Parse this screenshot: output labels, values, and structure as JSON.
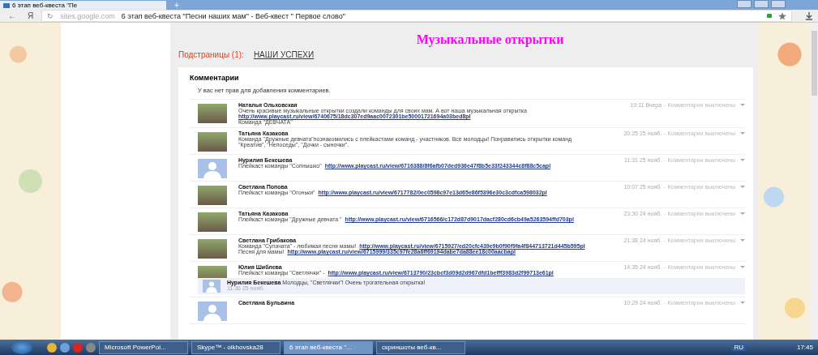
{
  "browser": {
    "tab_title": "6 этап веб-квеста \"Пе",
    "new_tab": "+",
    "back": "←",
    "logo": "Я",
    "reload": "↻",
    "domain": "sites.google.com",
    "page_title": "6 этап веб-квеста \"Песни наших мам\" - Веб-квест \" Первое слово\""
  },
  "page": {
    "title": "Музыкальные открытки",
    "subpages_label": "Подстраницы (1):",
    "subpages": [
      "НАШИ УСПЕХИ"
    ]
  },
  "comments_section": {
    "heading": "Комментарии",
    "notice": "У вас нет прав для добавления комментариев.",
    "comments": [
      {
        "kind": "photo",
        "name": "Наталья Ольховская",
        "time": "19:11 Вчера",
        "status": "- Комментарии выключены",
        "lines": [
          [
            {
              "kind": "text",
              "text": "Очень красивые музыкальные открытки создали команды для своих мам. А вот наша музыкальная открытка"
            }
          ],
          [
            {
              "kind": "link",
              "text": "http://www.playcast.ru/view/6740675/18dc307ed9aac0072301be50001721694a03bed8pl"
            }
          ],
          [
            {
              "kind": "text",
              "text": "Команда \"ДЕВЧАТА\""
            }
          ]
        ]
      },
      {
        "kind": "photo",
        "name": "Татьяна Казакова",
        "time": "20:25 25 нояб.",
        "status": "- Комментарии выключены",
        "lines": [
          [
            {
              "kind": "text",
              "text": "Команда \"Дружные девчата\"познакомились с плейкастами команд - участников. Все молодцы! Понравились открытки команд"
            }
          ],
          [
            {
              "kind": "text",
              "text": "\"Креатив\", \"Непоседы\", \"Дочки - сыночки\"."
            }
          ]
        ]
      },
      {
        "kind": "silhouette",
        "name": "Нурилия Бекешева",
        "time": "11:31 25 нояб.",
        "status": "- Комментарии выключены",
        "lines": [
          [
            {
              "kind": "text",
              "text": "Плейкаст команды \"Солнышко\""
            },
            {
              "kind": "link",
              "text": "http://www.playcast.ru/view/6716388/8f6afb07ded936e47f8b5e33f243344c8f88c5capl"
            }
          ]
        ]
      },
      {
        "kind": "photo",
        "name": "Светлана Попова",
        "time": "10:07 25 нояб.",
        "status": "- Комментарии выключены",
        "lines": [
          [
            {
              "kind": "text",
              "text": "Плейкаст команды \"Огоньки\""
            },
            {
              "kind": "link",
              "text": "http://www.playcast.ru/view/6717782/0ec0598c97e13d65e86f5396e30c3cdfca598032pl"
            }
          ]
        ]
      },
      {
        "kind": "photo",
        "name": "Татьяна Казакова",
        "time": "23:30 24 нояб.",
        "status": "- Комментарии выключены",
        "lines": [
          [
            {
              "kind": "text",
              "text": "Плейкаст команды \"Дружные девчата \""
            },
            {
              "kind": "link",
              "text": "http://www.playcast.ru/view/6716566/c172d87d9017dacf280cd6cb49a5263594ffd703pl"
            }
          ]
        ]
      },
      {
        "kind": "photo",
        "name": "Светлана Грибакова",
        "time": "21:38 24 нояб.",
        "status": "- Комментарии выключены",
        "lines": [
          [
            {
              "kind": "text",
              "text": "Команда \"Сулачата\" - любимая песня мамы!"
            },
            {
              "kind": "link",
              "text": "http://www.playcast.ru/view/6715927/ed20cfc439e9b0f90f9fa4f844713721d445b595pl"
            }
          ],
          [
            {
              "kind": "text",
              "text": "Песня для мамы!"
            },
            {
              "kind": "link",
              "text": "http://www.playcast.ru/view/6715999/335c97fe28a6ff69194dabe7da88ee18c00aacbapl"
            }
          ]
        ]
      },
      {
        "kind": "photo",
        "name": "Юлия Шиблева",
        "time": "14:35 24 нояб.",
        "status": "- Комментарии выключены",
        "lines": [
          [
            {
              "kind": "text",
              "text": "Плейкаст команды \"Светлячки\" -"
            },
            {
              "kind": "link",
              "text": "http://www.playcast.ru/view/6713790/23cbcf3d09d2d967dfd1befff3983d2f99713e61pl"
            }
          ]
        ],
        "replies": [
          {
            "kind": "silhouette",
            "name": "Нурилия Бекешева",
            "text": "Молодцы, \"Светлячки\"! Очень трогательная открытка!",
            "time": "11:36 25 нояб."
          }
        ]
      },
      {
        "kind": "silhouette",
        "name": "Светлана Бульвина",
        "time": "10:29 24 нояб.",
        "status": "- Комментарии выключены"
      }
    ]
  },
  "taskbar": {
    "items": [
      {
        "label": "Microsoft PowerPoi...",
        "selected": false
      },
      {
        "label": "Skype™ - olkhovska28",
        "selected": false
      },
      {
        "label": "6 этап веб-квеста \"...",
        "selected": true
      },
      {
        "label": "скриншоты веб-кв...",
        "selected": false
      }
    ],
    "language": "RU",
    "clock": "17:45"
  }
}
